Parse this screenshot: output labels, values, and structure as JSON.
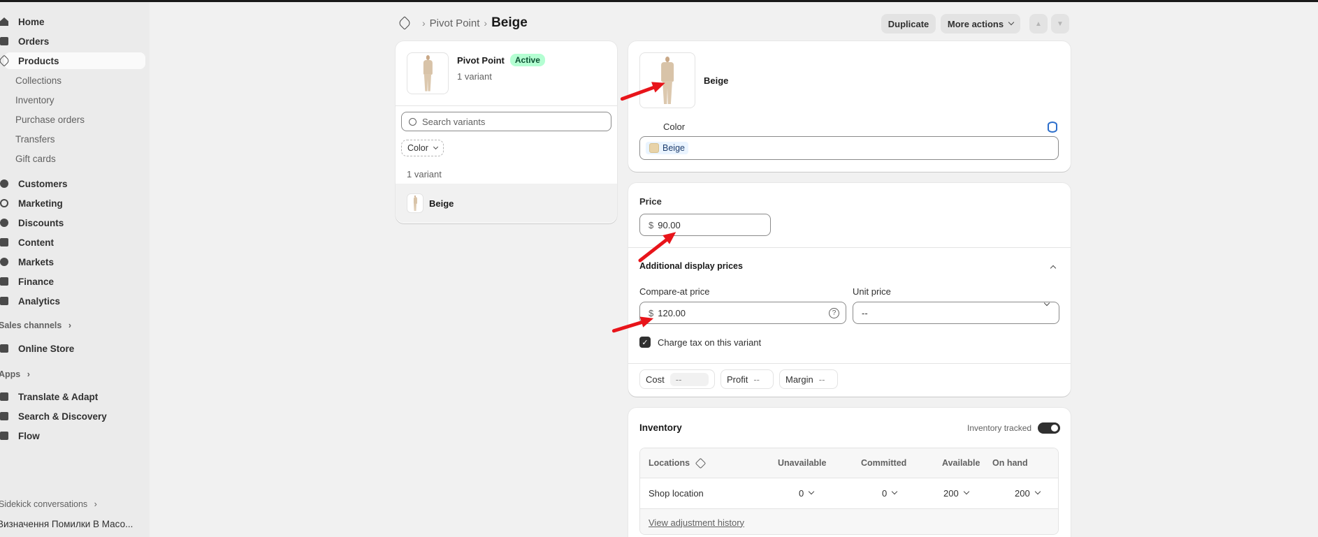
{
  "sidebar": {
    "main": [
      {
        "label": "Home",
        "icon": "home-icon"
      },
      {
        "label": "Orders",
        "icon": "inbox-icon"
      },
      {
        "label": "Products",
        "icon": "tag-icon"
      }
    ],
    "product_sub": [
      "Collections",
      "Inventory",
      "Purchase orders",
      "Transfers",
      "Gift cards"
    ],
    "secondary": [
      {
        "label": "Customers",
        "icon": "person-icon"
      },
      {
        "label": "Marketing",
        "icon": "target-icon"
      },
      {
        "label": "Discounts",
        "icon": "discount-icon"
      },
      {
        "label": "Content",
        "icon": "content-icon"
      },
      {
        "label": "Markets",
        "icon": "globe-icon"
      },
      {
        "label": "Finance",
        "icon": "bank-icon"
      },
      {
        "label": "Analytics",
        "icon": "chart-icon"
      }
    ],
    "sales_channels_label": "Sales channels",
    "online_store": "Online Store",
    "apps_label": "Apps",
    "apps": [
      "Translate & Adapt",
      "Search & Discovery",
      "Flow"
    ],
    "sidekick_label": "Sidekick conversations",
    "conversation": "Визначення Помилки В Масо..."
  },
  "header": {
    "breadcrumb_parent": "Pivot Point",
    "breadcrumb_current": "Beige",
    "duplicate": "Duplicate",
    "more_actions": "More actions"
  },
  "product_card": {
    "title": "Pivot Point",
    "status": "Active",
    "variant_count": "1 variant",
    "search_placeholder": "Search variants",
    "filter": "Color",
    "list_count": "1 variant",
    "variant_name": "Beige"
  },
  "variant_card": {
    "name": "Beige",
    "option_label": "Color",
    "option_value": "Beige",
    "swatch_color": "#e8d3a9"
  },
  "pricing": {
    "price_label": "Price",
    "currency": "$",
    "price": "90.00",
    "additional_title": "Additional display prices",
    "compare_label": "Compare-at price",
    "compare_value": "120.00",
    "unit_label": "Unit price",
    "unit_value": "--",
    "tax_label": "Charge tax on this variant",
    "tax_checked": true,
    "cost_label": "Cost",
    "cost_value": "--",
    "profit_label": "Profit",
    "profit_value": "--",
    "margin_label": "Margin",
    "margin_value": "--"
  },
  "inventory": {
    "title": "Inventory",
    "tracked_label": "Inventory tracked",
    "columns": [
      "Locations",
      "Unavailable",
      "Committed",
      "Available",
      "On hand"
    ],
    "rows": [
      {
        "location": "Shop location",
        "unavailable": "0",
        "committed": "0",
        "available": "200",
        "on_hand": "200"
      }
    ],
    "history_link": "View adjustment history"
  }
}
